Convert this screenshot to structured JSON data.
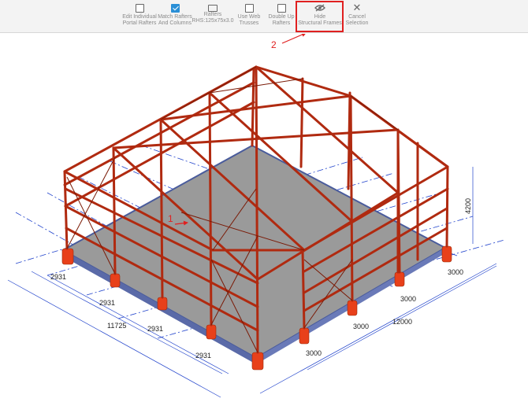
{
  "toolbar": {
    "edit_individual": "Edit Individual\nPortal Rafters",
    "match_rafters": "Match Rafters\nAnd Columns",
    "rafters": "Rafters\nRHS:125x75x3.0",
    "web_trusses": "Use Web\nTrusses",
    "double_up": "Double Up\nRafters",
    "hide_frames": "Hide\nStructural Frames",
    "cancel": "Cancel\nSelection"
  },
  "callouts": {
    "one": "1",
    "two": "2"
  },
  "dimensions": {
    "left_1": "2931",
    "left_2": "2931",
    "left_total": "11725",
    "left_3": "2931",
    "left_4": "2931",
    "right_1": "3000",
    "right_2": "3000",
    "right_3": "3000",
    "right_total": "12000",
    "right_4": "3000",
    "height": "4200"
  },
  "colors": {
    "steel": "#b02a10",
    "steel_dark": "#6e1404",
    "slab": "#8f8f8f",
    "pier": "#e8401a",
    "gridline": "#2244cc",
    "highlight": "#e02020"
  }
}
